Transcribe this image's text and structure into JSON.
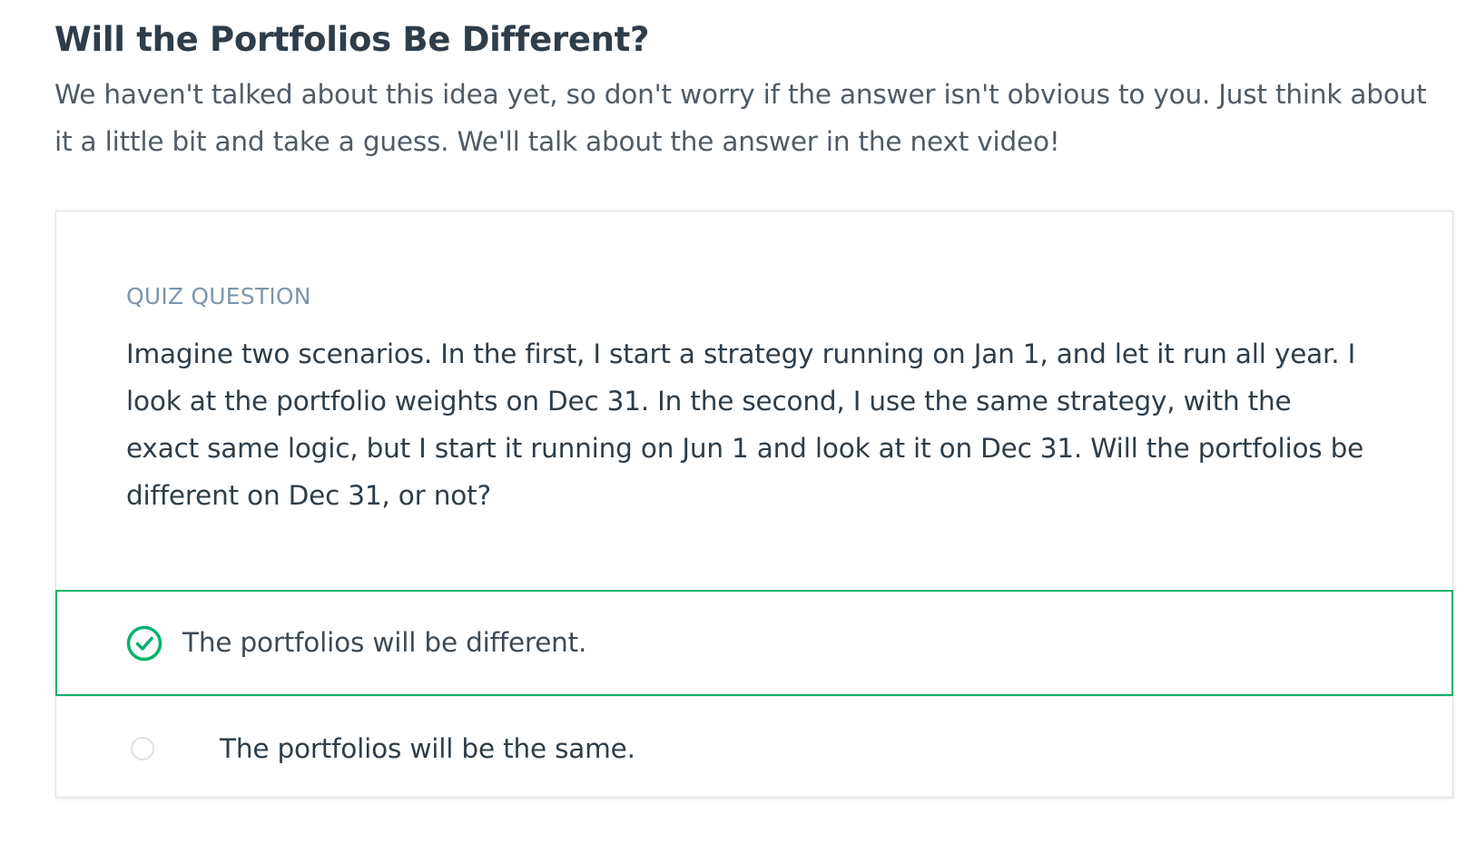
{
  "page": {
    "title": "Will the Portfolios Be Different?",
    "intro": "We haven't talked about this idea yet, so don't worry if the answer isn't obvious to you. Just think about it a little bit and take a guess. We'll talk about the answer in the next video!"
  },
  "quiz": {
    "label": "QUIZ QUESTION",
    "question": "Imagine two scenarios. In the first, I start a strategy running on Jan 1, and let it run all year. I look at the portfolio weights on Dec 31. In the second, I use the same strategy, with the exact same logic, but I start it running on Jun 1 and look at it on Dec 31. Will the portfolios be different on Dec 31, or not?",
    "options": [
      {
        "label": "The portfolios will be different.",
        "selected": true,
        "icon": "check-circle-icon"
      },
      {
        "label": "The portfolios will be the same.",
        "selected": false,
        "icon": "radio-empty-icon"
      }
    ]
  },
  "colors": {
    "title_text": "#2e3d49",
    "label_text": "#7d97ad",
    "selected_border": "#02b36a",
    "check_green": "#02b36a",
    "radio_border": "#dbe2e8"
  }
}
